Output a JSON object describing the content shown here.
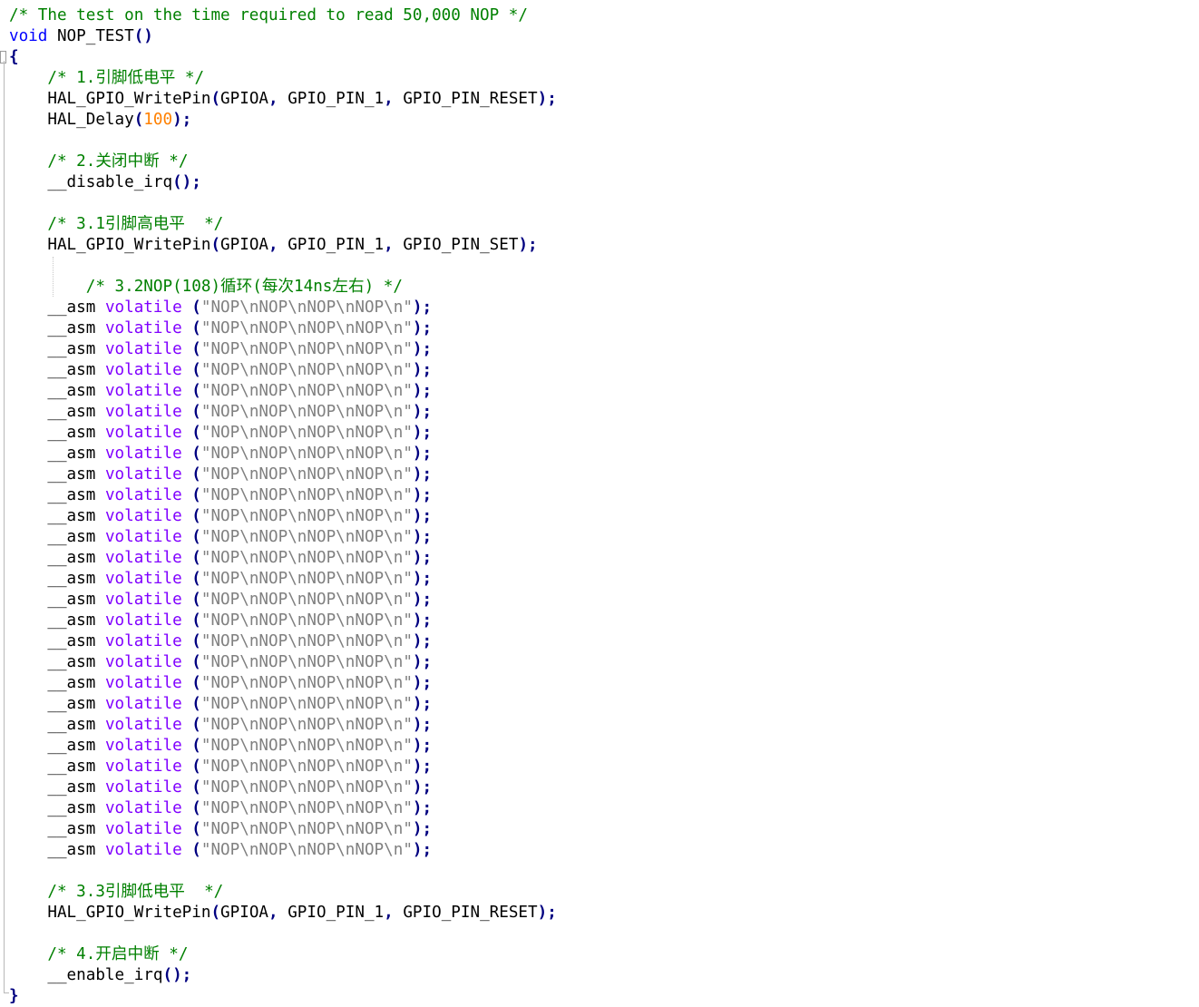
{
  "editor": {
    "colors": {
      "comment": "#008000",
      "keyword": "#0000ff",
      "volatile": "#8000ff",
      "string": "#808080",
      "number": "#ff8000",
      "operator": "#000080",
      "plain": "#000000"
    },
    "lines": [
      [
        {
          "t": "comment",
          "v": "/* The test on the time required to read 50,000 NOP */"
        }
      ],
      [
        {
          "t": "keyword",
          "v": "void"
        },
        {
          "t": "plain",
          "v": " NOP_TEST"
        },
        {
          "t": "op",
          "v": "()"
        }
      ],
      [
        {
          "t": "op",
          "v": "{"
        }
      ],
      [
        {
          "t": "plain",
          "v": "    "
        },
        {
          "t": "comment",
          "v": "/* 1.引脚低电平 */"
        }
      ],
      [
        {
          "t": "plain",
          "v": "    HAL_GPIO_WritePin"
        },
        {
          "t": "op",
          "v": "("
        },
        {
          "t": "plain",
          "v": "GPIOA"
        },
        {
          "t": "op",
          "v": ","
        },
        {
          "t": "plain",
          "v": " GPIO_PIN_1"
        },
        {
          "t": "op",
          "v": ","
        },
        {
          "t": "plain",
          "v": " GPIO_PIN_RESET"
        },
        {
          "t": "op",
          "v": ");"
        }
      ],
      [
        {
          "t": "plain",
          "v": "    HAL_Delay"
        },
        {
          "t": "op",
          "v": "("
        },
        {
          "t": "number",
          "v": "100"
        },
        {
          "t": "op",
          "v": ");"
        }
      ],
      [],
      [
        {
          "t": "plain",
          "v": "    "
        },
        {
          "t": "comment",
          "v": "/* 2.关闭中断 */"
        }
      ],
      [
        {
          "t": "plain",
          "v": "    __disable_irq"
        },
        {
          "t": "op",
          "v": "();"
        }
      ],
      [],
      [
        {
          "t": "plain",
          "v": "    "
        },
        {
          "t": "comment",
          "v": "/* 3.1引脚高电平  */"
        }
      ],
      [
        {
          "t": "plain",
          "v": "    HAL_GPIO_WritePin"
        },
        {
          "t": "op",
          "v": "("
        },
        {
          "t": "plain",
          "v": "GPIOA"
        },
        {
          "t": "op",
          "v": ","
        },
        {
          "t": "plain",
          "v": " GPIO_PIN_1"
        },
        {
          "t": "op",
          "v": ","
        },
        {
          "t": "plain",
          "v": " GPIO_PIN_SET"
        },
        {
          "t": "op",
          "v": ");"
        }
      ],
      [],
      [
        {
          "t": "plain",
          "v": "        "
        },
        {
          "t": "comment",
          "v": "/* 3.2NOP(108)循环(每次14ns左右) */"
        }
      ],
      [
        {
          "t": "plain",
          "v": "    __asm "
        },
        {
          "t": "volatile",
          "v": "volatile"
        },
        {
          "t": "plain",
          "v": " "
        },
        {
          "t": "op",
          "v": "("
        },
        {
          "t": "string",
          "v": "\"NOP\\nNOP\\nNOP\\nNOP\\n\""
        },
        {
          "t": "op",
          "v": ");"
        }
      ],
      [
        {
          "t": "plain",
          "v": "    __asm "
        },
        {
          "t": "volatile",
          "v": "volatile"
        },
        {
          "t": "plain",
          "v": " "
        },
        {
          "t": "op",
          "v": "("
        },
        {
          "t": "string",
          "v": "\"NOP\\nNOP\\nNOP\\nNOP\\n\""
        },
        {
          "t": "op",
          "v": ");"
        }
      ],
      [
        {
          "t": "plain",
          "v": "    __asm "
        },
        {
          "t": "volatile",
          "v": "volatile"
        },
        {
          "t": "plain",
          "v": " "
        },
        {
          "t": "op",
          "v": "("
        },
        {
          "t": "string",
          "v": "\"NOP\\nNOP\\nNOP\\nNOP\\n\""
        },
        {
          "t": "op",
          "v": ");"
        }
      ],
      [
        {
          "t": "plain",
          "v": "    __asm "
        },
        {
          "t": "volatile",
          "v": "volatile"
        },
        {
          "t": "plain",
          "v": " "
        },
        {
          "t": "op",
          "v": "("
        },
        {
          "t": "string",
          "v": "\"NOP\\nNOP\\nNOP\\nNOP\\n\""
        },
        {
          "t": "op",
          "v": ");"
        }
      ],
      [
        {
          "t": "plain",
          "v": "    __asm "
        },
        {
          "t": "volatile",
          "v": "volatile"
        },
        {
          "t": "plain",
          "v": " "
        },
        {
          "t": "op",
          "v": "("
        },
        {
          "t": "string",
          "v": "\"NOP\\nNOP\\nNOP\\nNOP\\n\""
        },
        {
          "t": "op",
          "v": ");"
        }
      ],
      [
        {
          "t": "plain",
          "v": "    __asm "
        },
        {
          "t": "volatile",
          "v": "volatile"
        },
        {
          "t": "plain",
          "v": " "
        },
        {
          "t": "op",
          "v": "("
        },
        {
          "t": "string",
          "v": "\"NOP\\nNOP\\nNOP\\nNOP\\n\""
        },
        {
          "t": "op",
          "v": ");"
        }
      ],
      [
        {
          "t": "plain",
          "v": "    __asm "
        },
        {
          "t": "volatile",
          "v": "volatile"
        },
        {
          "t": "plain",
          "v": " "
        },
        {
          "t": "op",
          "v": "("
        },
        {
          "t": "string",
          "v": "\"NOP\\nNOP\\nNOP\\nNOP\\n\""
        },
        {
          "t": "op",
          "v": ");"
        }
      ],
      [
        {
          "t": "plain",
          "v": "    __asm "
        },
        {
          "t": "volatile",
          "v": "volatile"
        },
        {
          "t": "plain",
          "v": " "
        },
        {
          "t": "op",
          "v": "("
        },
        {
          "t": "string",
          "v": "\"NOP\\nNOP\\nNOP\\nNOP\\n\""
        },
        {
          "t": "op",
          "v": ");"
        }
      ],
      [
        {
          "t": "plain",
          "v": "    __asm "
        },
        {
          "t": "volatile",
          "v": "volatile"
        },
        {
          "t": "plain",
          "v": " "
        },
        {
          "t": "op",
          "v": "("
        },
        {
          "t": "string",
          "v": "\"NOP\\nNOP\\nNOP\\nNOP\\n\""
        },
        {
          "t": "op",
          "v": ");"
        }
      ],
      [
        {
          "t": "plain",
          "v": "    __asm "
        },
        {
          "t": "volatile",
          "v": "volatile"
        },
        {
          "t": "plain",
          "v": " "
        },
        {
          "t": "op",
          "v": "("
        },
        {
          "t": "string",
          "v": "\"NOP\\nNOP\\nNOP\\nNOP\\n\""
        },
        {
          "t": "op",
          "v": ");"
        }
      ],
      [
        {
          "t": "plain",
          "v": "    __asm "
        },
        {
          "t": "volatile",
          "v": "volatile"
        },
        {
          "t": "plain",
          "v": " "
        },
        {
          "t": "op",
          "v": "("
        },
        {
          "t": "string",
          "v": "\"NOP\\nNOP\\nNOP\\nNOP\\n\""
        },
        {
          "t": "op",
          "v": ");"
        }
      ],
      [
        {
          "t": "plain",
          "v": "    __asm "
        },
        {
          "t": "volatile",
          "v": "volatile"
        },
        {
          "t": "plain",
          "v": " "
        },
        {
          "t": "op",
          "v": "("
        },
        {
          "t": "string",
          "v": "\"NOP\\nNOP\\nNOP\\nNOP\\n\""
        },
        {
          "t": "op",
          "v": ");"
        }
      ],
      [
        {
          "t": "plain",
          "v": "    __asm "
        },
        {
          "t": "volatile",
          "v": "volatile"
        },
        {
          "t": "plain",
          "v": " "
        },
        {
          "t": "op",
          "v": "("
        },
        {
          "t": "string",
          "v": "\"NOP\\nNOP\\nNOP\\nNOP\\n\""
        },
        {
          "t": "op",
          "v": ");"
        }
      ],
      [
        {
          "t": "plain",
          "v": "    __asm "
        },
        {
          "t": "volatile",
          "v": "volatile"
        },
        {
          "t": "plain",
          "v": " "
        },
        {
          "t": "op",
          "v": "("
        },
        {
          "t": "string",
          "v": "\"NOP\\nNOP\\nNOP\\nNOP\\n\""
        },
        {
          "t": "op",
          "v": ");"
        }
      ],
      [
        {
          "t": "plain",
          "v": "    __asm "
        },
        {
          "t": "volatile",
          "v": "volatile"
        },
        {
          "t": "plain",
          "v": " "
        },
        {
          "t": "op",
          "v": "("
        },
        {
          "t": "string",
          "v": "\"NOP\\nNOP\\nNOP\\nNOP\\n\""
        },
        {
          "t": "op",
          "v": ");"
        }
      ],
      [
        {
          "t": "plain",
          "v": "    __asm "
        },
        {
          "t": "volatile",
          "v": "volatile"
        },
        {
          "t": "plain",
          "v": " "
        },
        {
          "t": "op",
          "v": "("
        },
        {
          "t": "string",
          "v": "\"NOP\\nNOP\\nNOP\\nNOP\\n\""
        },
        {
          "t": "op",
          "v": ");"
        }
      ],
      [
        {
          "t": "plain",
          "v": "    __asm "
        },
        {
          "t": "volatile",
          "v": "volatile"
        },
        {
          "t": "plain",
          "v": " "
        },
        {
          "t": "op",
          "v": "("
        },
        {
          "t": "string",
          "v": "\"NOP\\nNOP\\nNOP\\nNOP\\n\""
        },
        {
          "t": "op",
          "v": ");"
        }
      ],
      [
        {
          "t": "plain",
          "v": "    __asm "
        },
        {
          "t": "volatile",
          "v": "volatile"
        },
        {
          "t": "plain",
          "v": " "
        },
        {
          "t": "op",
          "v": "("
        },
        {
          "t": "string",
          "v": "\"NOP\\nNOP\\nNOP\\nNOP\\n\""
        },
        {
          "t": "op",
          "v": ");"
        }
      ],
      [
        {
          "t": "plain",
          "v": "    __asm "
        },
        {
          "t": "volatile",
          "v": "volatile"
        },
        {
          "t": "plain",
          "v": " "
        },
        {
          "t": "op",
          "v": "("
        },
        {
          "t": "string",
          "v": "\"NOP\\nNOP\\nNOP\\nNOP\\n\""
        },
        {
          "t": "op",
          "v": ");"
        }
      ],
      [
        {
          "t": "plain",
          "v": "    __asm "
        },
        {
          "t": "volatile",
          "v": "volatile"
        },
        {
          "t": "plain",
          "v": " "
        },
        {
          "t": "op",
          "v": "("
        },
        {
          "t": "string",
          "v": "\"NOP\\nNOP\\nNOP\\nNOP\\n\""
        },
        {
          "t": "op",
          "v": ");"
        }
      ],
      [
        {
          "t": "plain",
          "v": "    __asm "
        },
        {
          "t": "volatile",
          "v": "volatile"
        },
        {
          "t": "plain",
          "v": " "
        },
        {
          "t": "op",
          "v": "("
        },
        {
          "t": "string",
          "v": "\"NOP\\nNOP\\nNOP\\nNOP\\n\""
        },
        {
          "t": "op",
          "v": ");"
        }
      ],
      [
        {
          "t": "plain",
          "v": "    __asm "
        },
        {
          "t": "volatile",
          "v": "volatile"
        },
        {
          "t": "plain",
          "v": " "
        },
        {
          "t": "op",
          "v": "("
        },
        {
          "t": "string",
          "v": "\"NOP\\nNOP\\nNOP\\nNOP\\n\""
        },
        {
          "t": "op",
          "v": ");"
        }
      ],
      [
        {
          "t": "plain",
          "v": "    __asm "
        },
        {
          "t": "volatile",
          "v": "volatile"
        },
        {
          "t": "plain",
          "v": " "
        },
        {
          "t": "op",
          "v": "("
        },
        {
          "t": "string",
          "v": "\"NOP\\nNOP\\nNOP\\nNOP\\n\""
        },
        {
          "t": "op",
          "v": ");"
        }
      ],
      [
        {
          "t": "plain",
          "v": "    __asm "
        },
        {
          "t": "volatile",
          "v": "volatile"
        },
        {
          "t": "plain",
          "v": " "
        },
        {
          "t": "op",
          "v": "("
        },
        {
          "t": "string",
          "v": "\"NOP\\nNOP\\nNOP\\nNOP\\n\""
        },
        {
          "t": "op",
          "v": ");"
        }
      ],
      [
        {
          "t": "plain",
          "v": "    __asm "
        },
        {
          "t": "volatile",
          "v": "volatile"
        },
        {
          "t": "plain",
          "v": " "
        },
        {
          "t": "op",
          "v": "("
        },
        {
          "t": "string",
          "v": "\"NOP\\nNOP\\nNOP\\nNOP\\n\""
        },
        {
          "t": "op",
          "v": ");"
        }
      ],
      [
        {
          "t": "plain",
          "v": "    __asm "
        },
        {
          "t": "volatile",
          "v": "volatile"
        },
        {
          "t": "plain",
          "v": " "
        },
        {
          "t": "op",
          "v": "("
        },
        {
          "t": "string",
          "v": "\"NOP\\nNOP\\nNOP\\nNOP\\n\""
        },
        {
          "t": "op",
          "v": ");"
        }
      ],
      [
        {
          "t": "plain",
          "v": "    __asm "
        },
        {
          "t": "volatile",
          "v": "volatile"
        },
        {
          "t": "plain",
          "v": " "
        },
        {
          "t": "op",
          "v": "("
        },
        {
          "t": "string",
          "v": "\"NOP\\nNOP\\nNOP\\nNOP\\n\""
        },
        {
          "t": "op",
          "v": ");"
        }
      ],
      [],
      [
        {
          "t": "plain",
          "v": "    "
        },
        {
          "t": "comment",
          "v": "/* 3.3引脚低电平  */"
        }
      ],
      [
        {
          "t": "plain",
          "v": "    HAL_GPIO_WritePin"
        },
        {
          "t": "op",
          "v": "("
        },
        {
          "t": "plain",
          "v": "GPIOA"
        },
        {
          "t": "op",
          "v": ","
        },
        {
          "t": "plain",
          "v": " GPIO_PIN_1"
        },
        {
          "t": "op",
          "v": ","
        },
        {
          "t": "plain",
          "v": " GPIO_PIN_RESET"
        },
        {
          "t": "op",
          "v": ");"
        }
      ],
      [],
      [
        {
          "t": "plain",
          "v": "    "
        },
        {
          "t": "comment",
          "v": "/* 4.开启中断 */"
        }
      ],
      [
        {
          "t": "plain",
          "v": "    __enable_irq"
        },
        {
          "t": "op",
          "v": "();"
        }
      ],
      [
        {
          "t": "op",
          "v": "}"
        }
      ]
    ]
  }
}
